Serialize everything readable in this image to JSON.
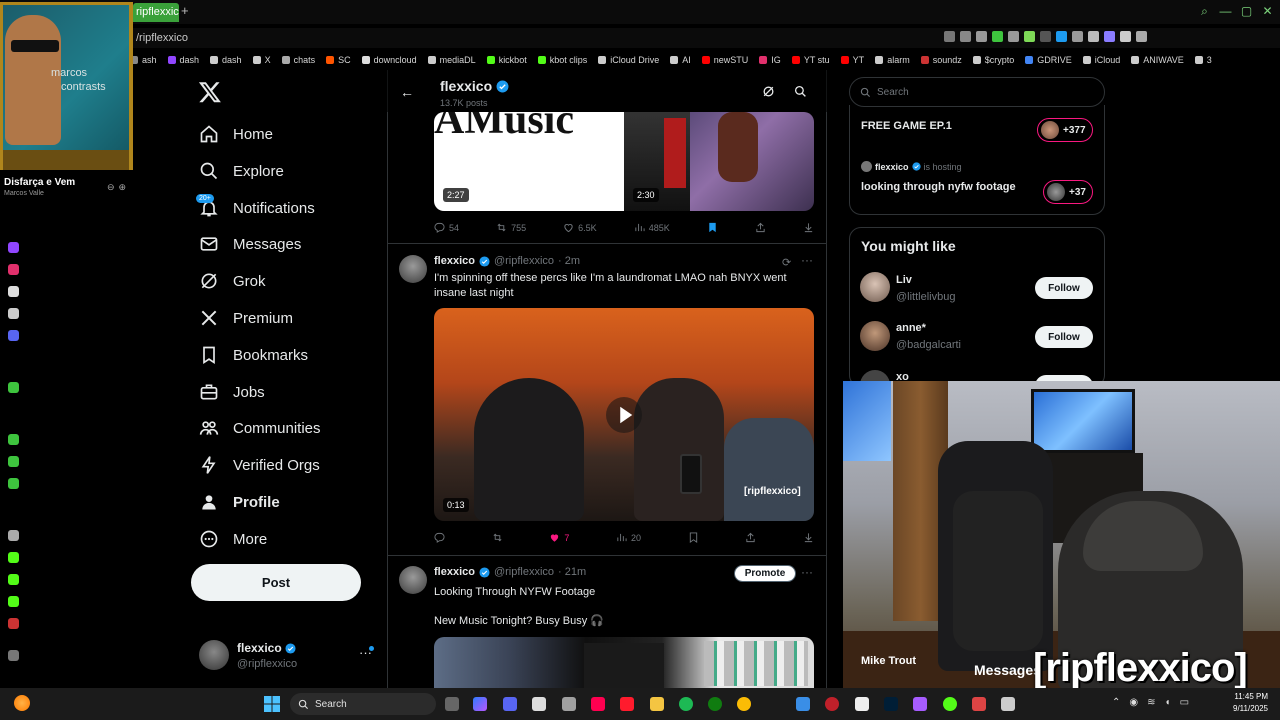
{
  "browser": {
    "tab_title": "ripflexxico",
    "new_tab_symbol": "+",
    "url": "/ripflexxico",
    "bookmarks": [
      "ash",
      "dash",
      "dash",
      "X",
      "chats",
      "SC",
      "downcloud",
      "mediaDL",
      "kickbot",
      "kbot clips",
      "iCloud Drive",
      "AI",
      "newSTU",
      "IG",
      "YT stu",
      "YT",
      "alarm",
      "soundz",
      "$crypto",
      "GDRIVE",
      "iCloud",
      "ANIWAVE",
      "3"
    ]
  },
  "music": {
    "album_text_1": "marcos",
    "album_text_2": "contrasts",
    "title": "Disfarça e Vem",
    "artist": "Marcos Valle"
  },
  "nav": {
    "items": [
      {
        "label": "Home",
        "icon": "home-icon"
      },
      {
        "label": "Explore",
        "icon": "search-icon"
      },
      {
        "label": "Notifications",
        "icon": "bell-icon"
      },
      {
        "label": "Messages",
        "icon": "mail-icon"
      },
      {
        "label": "Grok",
        "icon": "grok-icon"
      },
      {
        "label": "Premium",
        "icon": "x-icon"
      },
      {
        "label": "Bookmarks",
        "icon": "bookmark-icon"
      },
      {
        "label": "Jobs",
        "icon": "briefcase-icon"
      },
      {
        "label": "Communities",
        "icon": "people-icon"
      },
      {
        "label": "Verified Orgs",
        "icon": "lightning-icon"
      },
      {
        "label": "Profile",
        "icon": "person-icon"
      },
      {
        "label": "More",
        "icon": "more-circle-icon"
      }
    ],
    "notif_badge": "20+",
    "post_label": "Post",
    "account": {
      "name": "flexxico",
      "handle": "@ripflexxico"
    }
  },
  "feed": {
    "header_name": "flexxico",
    "header_count": "13.7K posts",
    "tweet0": {
      "durations": [
        "2:27",
        "2:30"
      ],
      "replies": "54",
      "reposts": "755",
      "likes": "6.5K",
      "views": "485K"
    },
    "tweet1": {
      "name": "flexxico",
      "handle": "@ripflexxico",
      "time": "· 2m",
      "text": "I'm spinning off these percs like I'm a laundromat LMAO nah BNYX went insane last night",
      "duration": "0:13",
      "watermark": "[ripflexxico]",
      "likes": "7",
      "views": "20"
    },
    "tweet2": {
      "name": "flexxico",
      "handle": "@ripflexxico",
      "time": "· 21m",
      "promote": "Promote",
      "line1": "Looking Through NYFW Footage",
      "line2": "New Music Tonight? Busy Busy 🎧"
    }
  },
  "sidebar": {
    "search_placeholder": "Search",
    "space1": {
      "title": "FREE GAME EP.1",
      "count": "+377"
    },
    "space2": {
      "host": "flexxico",
      "host_suffix": "is hosting",
      "title": "looking through nyfw footage",
      "count": "+37"
    },
    "wtf_title": "You might like",
    "suggestions": [
      {
        "name": "Liv",
        "handle": "@littlelivbug",
        "button": "Follow"
      },
      {
        "name": "anne*",
        "handle": "@badgalcarti",
        "button": "Follow"
      },
      {
        "name": "xo",
        "handle": "",
        "button": "Follow"
      }
    ]
  },
  "webcam": {
    "name_label": "Mike Trout",
    "messages_label": "Messages",
    "brand": "[ripflexxico]"
  },
  "taskbar": {
    "search_label": "Search",
    "time": "11:45 PM",
    "date": "9/11/2025"
  },
  "colors": {
    "accent": "#1d9bf0",
    "like": "#f91880",
    "tab_green": "#3aa13a"
  }
}
